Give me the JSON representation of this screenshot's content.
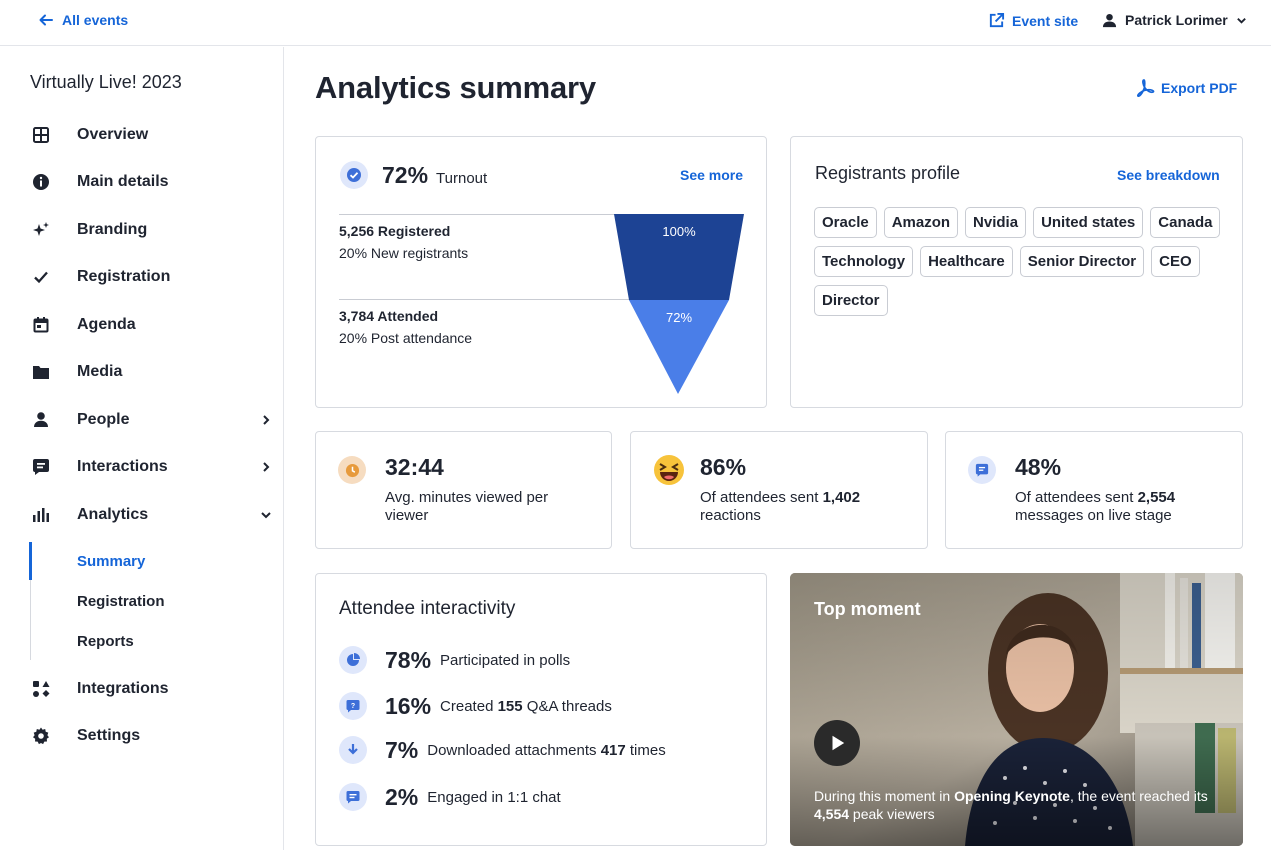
{
  "topbar": {
    "back_label": "All events",
    "event_site_label": "Event site",
    "user_name": "Patrick Lorimer"
  },
  "sidebar": {
    "event_name": "Virtually Live! 2023",
    "items": [
      {
        "label": "Overview",
        "icon": "grid-icon"
      },
      {
        "label": "Main details",
        "icon": "info-icon"
      },
      {
        "label": "Branding",
        "icon": "sparkles-icon"
      },
      {
        "label": "Registration",
        "icon": "check-icon"
      },
      {
        "label": "Agenda",
        "icon": "calendar-icon"
      },
      {
        "label": "Media",
        "icon": "folder-icon"
      },
      {
        "label": "People",
        "icon": "person-icon"
      },
      {
        "label": "Interactions",
        "icon": "chat-icon"
      },
      {
        "label": "Analytics",
        "icon": "bar-chart-icon"
      },
      {
        "label": "Integrations",
        "icon": "shapes-icon"
      },
      {
        "label": "Settings",
        "icon": "gear-icon"
      }
    ],
    "analytics_sub": [
      "Summary",
      "Registration",
      "Reports"
    ]
  },
  "main": {
    "title": "Analytics summary",
    "export_label": "Export PDF"
  },
  "turnout": {
    "percent": "72%",
    "label": "Turnout",
    "link": "See more",
    "registered_line": "5,256 Registered",
    "registered_sub": "20% New registrants",
    "attended_line": "3,784 Attended",
    "attended_sub": "20% Post attendance",
    "funnel_top_label": "100%",
    "funnel_bottom_label": "72%",
    "funnel_top_value": 100,
    "funnel_bottom_value": 72,
    "funnel_top_color": "#1d4394",
    "funnel_bottom_color": "#4a7ee8"
  },
  "profile": {
    "title": "Registrants profile",
    "link": "See breakdown",
    "chips": [
      "Oracle",
      "Amazon",
      "Nvidia",
      "United states",
      "Canada",
      "Technology",
      "Healthcare",
      "Senior Director",
      "CEO",
      "Director"
    ]
  },
  "stats": [
    {
      "value": "32:44",
      "desc": "Avg. minutes viewed per viewer",
      "icon": "clock-icon",
      "color": "#f6dcc0"
    },
    {
      "value": "86%",
      "desc_pre": "Of attendees sent ",
      "desc_bold": "1,402",
      "desc_post": " reactions",
      "icon": "laughing-emoji-icon"
    },
    {
      "value": "48%",
      "desc_pre": "Of attendees sent ",
      "desc_bold": "2,554",
      "desc_post": " messages on live stage",
      "icon": "chat-icon",
      "color": "#dfe7fb"
    }
  ],
  "interactivity": {
    "title": "Attendee interactivity",
    "rows": [
      {
        "pct": "78%",
        "pre": "Participated in polls",
        "bold": "",
        "post": "",
        "icon": "pie-icon"
      },
      {
        "pct": "16%",
        "pre": "Created ",
        "bold": "155",
        "post": " Q&A threads",
        "icon": "question-icon"
      },
      {
        "pct": "7%",
        "pre": "Downloaded attachments ",
        "bold": "417",
        "post": " times",
        "icon": "download-icon"
      },
      {
        "pct": "2%",
        "pre": "Engaged in 1:1 chat",
        "bold": "",
        "post": "",
        "icon": "chat-icon"
      }
    ]
  },
  "moment": {
    "title": "Top moment",
    "caption_pre": "During this moment in ",
    "caption_bold1": "Opening Keynote",
    "caption_mid": ", the event reached its ",
    "caption_bold2": "4,554",
    "caption_post": " peak viewers"
  },
  "colors": {
    "accent": "#1565d8",
    "text": "#1f2430",
    "border": "#d7dae0"
  }
}
